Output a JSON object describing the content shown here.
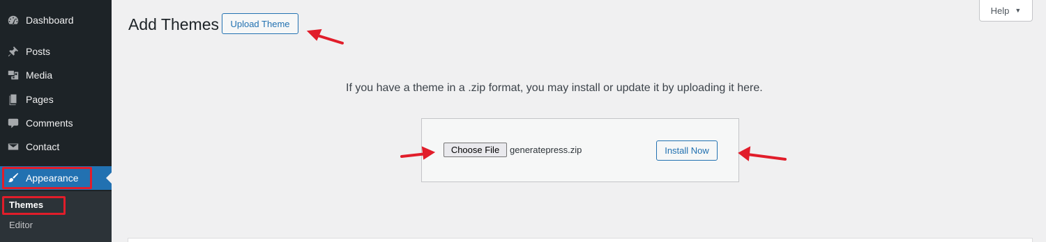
{
  "sidebar": {
    "items": [
      {
        "label": "Dashboard",
        "icon": "dashboard-icon"
      },
      {
        "label": "Posts",
        "icon": "pin-icon"
      },
      {
        "label": "Media",
        "icon": "media-icon"
      },
      {
        "label": "Pages",
        "icon": "pages-icon"
      },
      {
        "label": "Comments",
        "icon": "comments-icon"
      },
      {
        "label": "Contact",
        "icon": "envelope-icon"
      },
      {
        "label": "Appearance",
        "icon": "brush-icon"
      }
    ],
    "submenu": [
      {
        "label": "Themes"
      },
      {
        "label": "Editor"
      }
    ]
  },
  "header": {
    "title": "Add Themes",
    "upload_button": "Upload Theme",
    "help_tab": "Help",
    "help_caret": "▼"
  },
  "upload": {
    "description": "If you have a theme in a .zip format, you may install or update it by uploading it here.",
    "choose_file": "Choose File",
    "file_name": "generatepress.zip",
    "install_button": "Install Now"
  },
  "colors": {
    "sidebar_bg": "#1d2327",
    "accent": "#2271b1",
    "annotation": "#e11d2a"
  }
}
